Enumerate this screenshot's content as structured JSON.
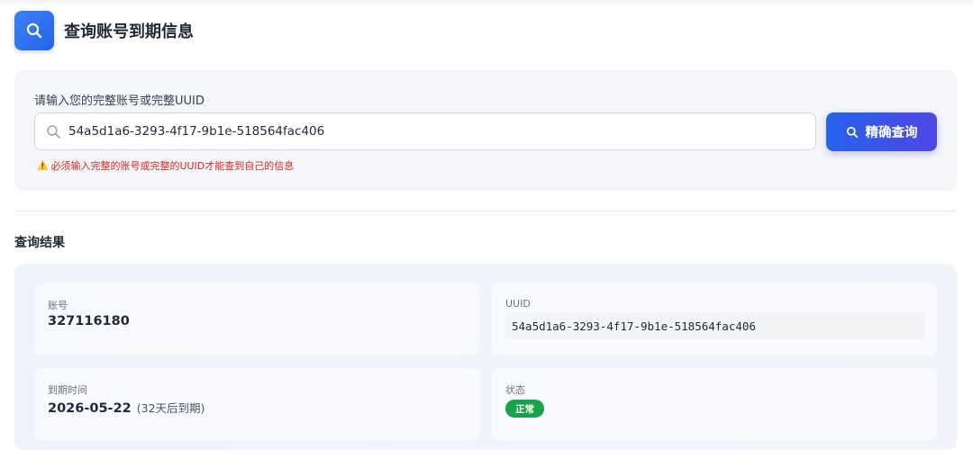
{
  "header": {
    "title": "查询账号到期信息",
    "icon": "search-icon"
  },
  "search": {
    "label": "请输入您的完整账号或完整UUID",
    "value": "54a5d1a6-3293-4f17-9b1e-518564fac406",
    "button_label": "精确查询",
    "warning": "必须输入完整的账号或完整的UUID才能查到自己的信息",
    "warning_icon": "⚠️"
  },
  "results": {
    "title": "查询结果",
    "account": {
      "label": "账号",
      "value": "327116180"
    },
    "uuid": {
      "label": "UUID",
      "value": "54a5d1a6-3293-4f17-9b1e-518564fac406"
    },
    "expiry": {
      "label": "到期时间",
      "value": "2026-05-22",
      "remaining": "(32天后到期)"
    },
    "status": {
      "label": "状态",
      "value": "正常",
      "color": "#16a34a"
    }
  },
  "colors": {
    "accent": "#2563eb",
    "accent_end": "#4f46e5",
    "warning": "#dc2626"
  }
}
